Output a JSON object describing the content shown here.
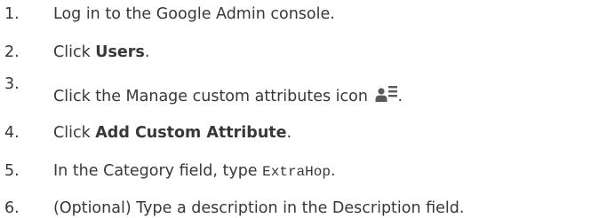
{
  "steps": [
    {
      "number": "1.",
      "text": "Log in to the Google Admin console."
    },
    {
      "number": "2.",
      "prefix": "Click ",
      "bold": "Users",
      "suffix": "."
    },
    {
      "number": "3.",
      "prefix": "Click the Manage custom attributes icon ",
      "icon": "manage-custom-attributes-icon",
      "suffix": "."
    },
    {
      "number": "4.",
      "prefix": "Click ",
      "bold": "Add Custom Attribute",
      "suffix": "."
    },
    {
      "number": "5.",
      "prefix": "In the Category field, type ",
      "code": "ExtraHop",
      "suffix": "."
    },
    {
      "number": "6.",
      "text": "(Optional) Type a description in the Description field."
    }
  ],
  "colors": {
    "text": "#383838",
    "icon": "#5a5a5a"
  }
}
